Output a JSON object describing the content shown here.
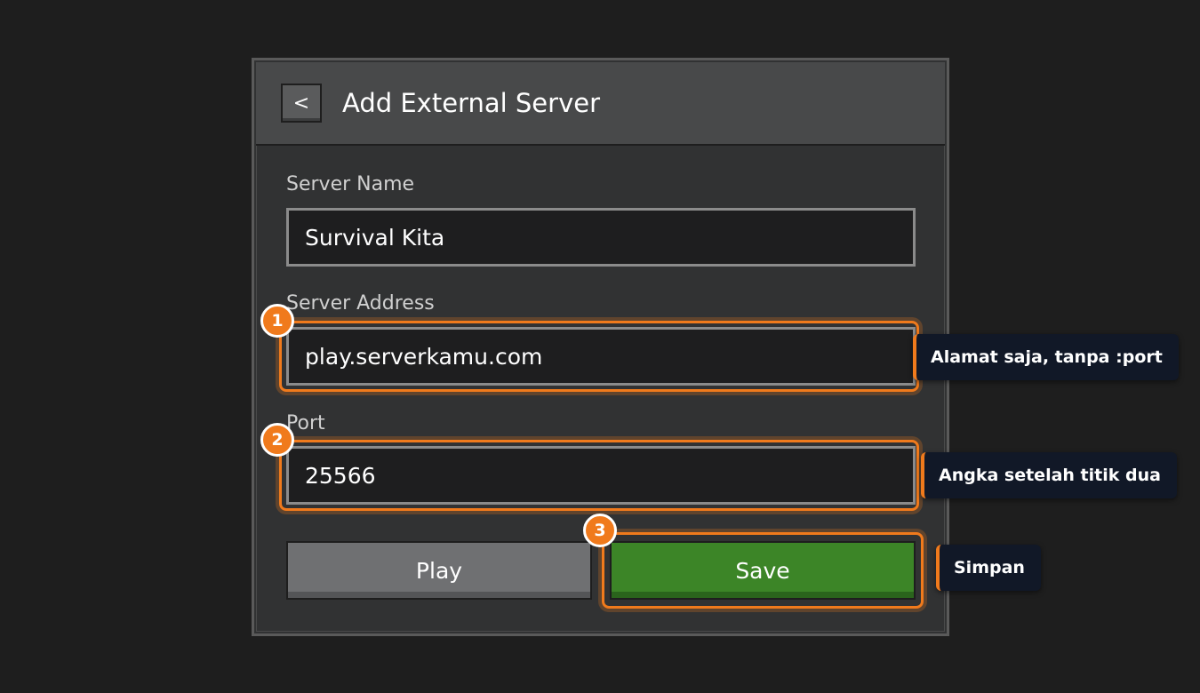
{
  "header": {
    "back_label": "<",
    "title": "Add External Server"
  },
  "fields": {
    "server_name": {
      "label": "Server Name",
      "value": "Survival Kita"
    },
    "server_address": {
      "label": "Server Address",
      "value": "play.serverkamu.com"
    },
    "port": {
      "label": "Port",
      "value": "25566"
    }
  },
  "buttons": {
    "play_label": "Play",
    "save_label": "Save"
  },
  "annotations": [
    {
      "badge": "1",
      "text": "Alamat saja, tanpa :port"
    },
    {
      "badge": "2",
      "text": "Angka setelah titik dua"
    },
    {
      "badge": "3",
      "text": "Simpan"
    }
  ],
  "colors": {
    "background": "#1e1e1e",
    "panel": "#313233",
    "header": "#48494a",
    "accent_orange": "#f07a1c",
    "save_green": "#3c8527",
    "play_gray": "#6f7072",
    "callout_bg": "#111827"
  }
}
